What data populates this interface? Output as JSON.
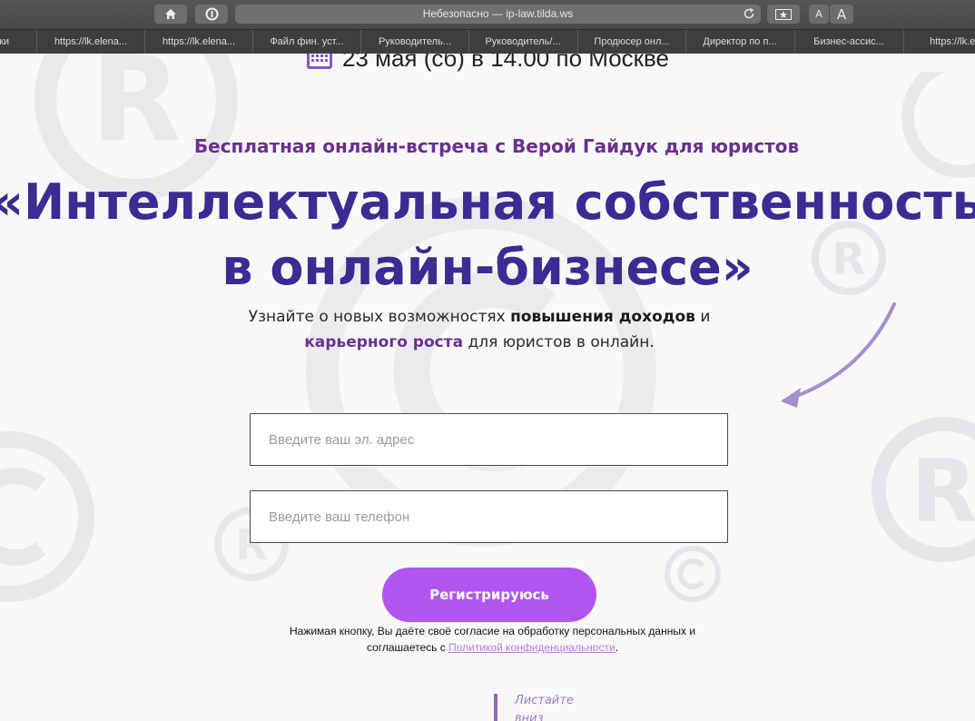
{
  "browser": {
    "address_text": "Небезопасно — ip-law.tilda.ws",
    "font_small": "A",
    "font_large": "A",
    "tabs": [
      "...ки",
      "https://lk.elena...",
      "https://lk.elena...",
      "Файл фин. уст...",
      "Руководитель...",
      "Руководитель/...",
      "Продюсер онл...",
      "Директор по п...",
      "Бизнес-ассис...",
      "https://lk.el..."
    ]
  },
  "hero": {
    "date": "23 мая (сб) в 14.00 по Москве",
    "subtitle": "Бесплатная онлайн-встреча с Верой Гайдук для юристов",
    "headline_line1": "«Интеллектуальная собственность",
    "headline_line2": "в онлайн-бизнесе»",
    "desc_part1": "Узнайте о новых возможностях ",
    "desc_bold": "повышения доходов",
    "desc_part2": " и",
    "desc_accent": "карьерного роста",
    "desc_part3": " для юристов в онлайн."
  },
  "form": {
    "email_placeholder": "Введите ваш эл. адрес",
    "phone_placeholder": "Введите ваш телефон",
    "submit_label": "Регистрируюсь",
    "consent_text": "Нажимая кнопку, Вы даёте своё согласие на обработку персональных данных и",
    "consent_text2": "соглашаетесь с ",
    "consent_link": "Политикой конфиденциальности",
    "consent_tail": "."
  },
  "scroll_hint": {
    "line1": "Листайте",
    "line2": "вниз"
  },
  "colors": {
    "accent_purple": "#6b2f8f",
    "headline_indigo": "#3a2c92",
    "button": "#b255f0"
  }
}
